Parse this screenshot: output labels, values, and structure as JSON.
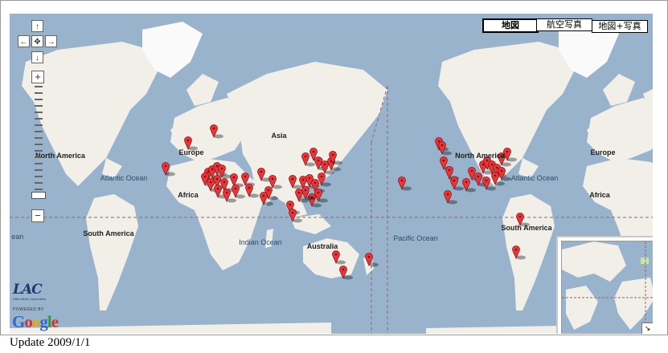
{
  "map_type_buttons": {
    "map": "地図",
    "satellite": "航空写真",
    "hybrid": "地図+写真"
  },
  "labels": {
    "north_america_w": "North America",
    "north_america_e": "North America",
    "south_america": "South America",
    "south_america_e": "South America",
    "europe": "Europe",
    "europe_e": "Europe",
    "asia": "Asia",
    "africa": "Africa",
    "africa_e": "Africa",
    "australia": "Australia",
    "atlantic": "Atlantic Ocean",
    "atlantic_e": "Atlantic Ocean",
    "pacific": "Pacific Ocean",
    "indian": "Indian Ocean",
    "atlantic_edge": "tic ean"
  },
  "zoom": {
    "plus": "+",
    "minus": "−"
  },
  "pan": {
    "up": "↑",
    "down": "↓",
    "left": "←",
    "right": "→",
    "center": "✥"
  },
  "branding": {
    "lac": "LAC",
    "lac_sub": "Little eArth Corporation",
    "powered_by": "POWERED BY",
    "google": [
      "G",
      "o",
      "o",
      "g",
      "l",
      "e"
    ]
  },
  "overview_toggle": "↘",
  "footer": {
    "update": "Update 2009/1/1"
  },
  "colors": {
    "ocean": "#99b3cc",
    "land": "#f2efe9",
    "marker": "#e8363a",
    "greenland": "#fafafa"
  }
}
